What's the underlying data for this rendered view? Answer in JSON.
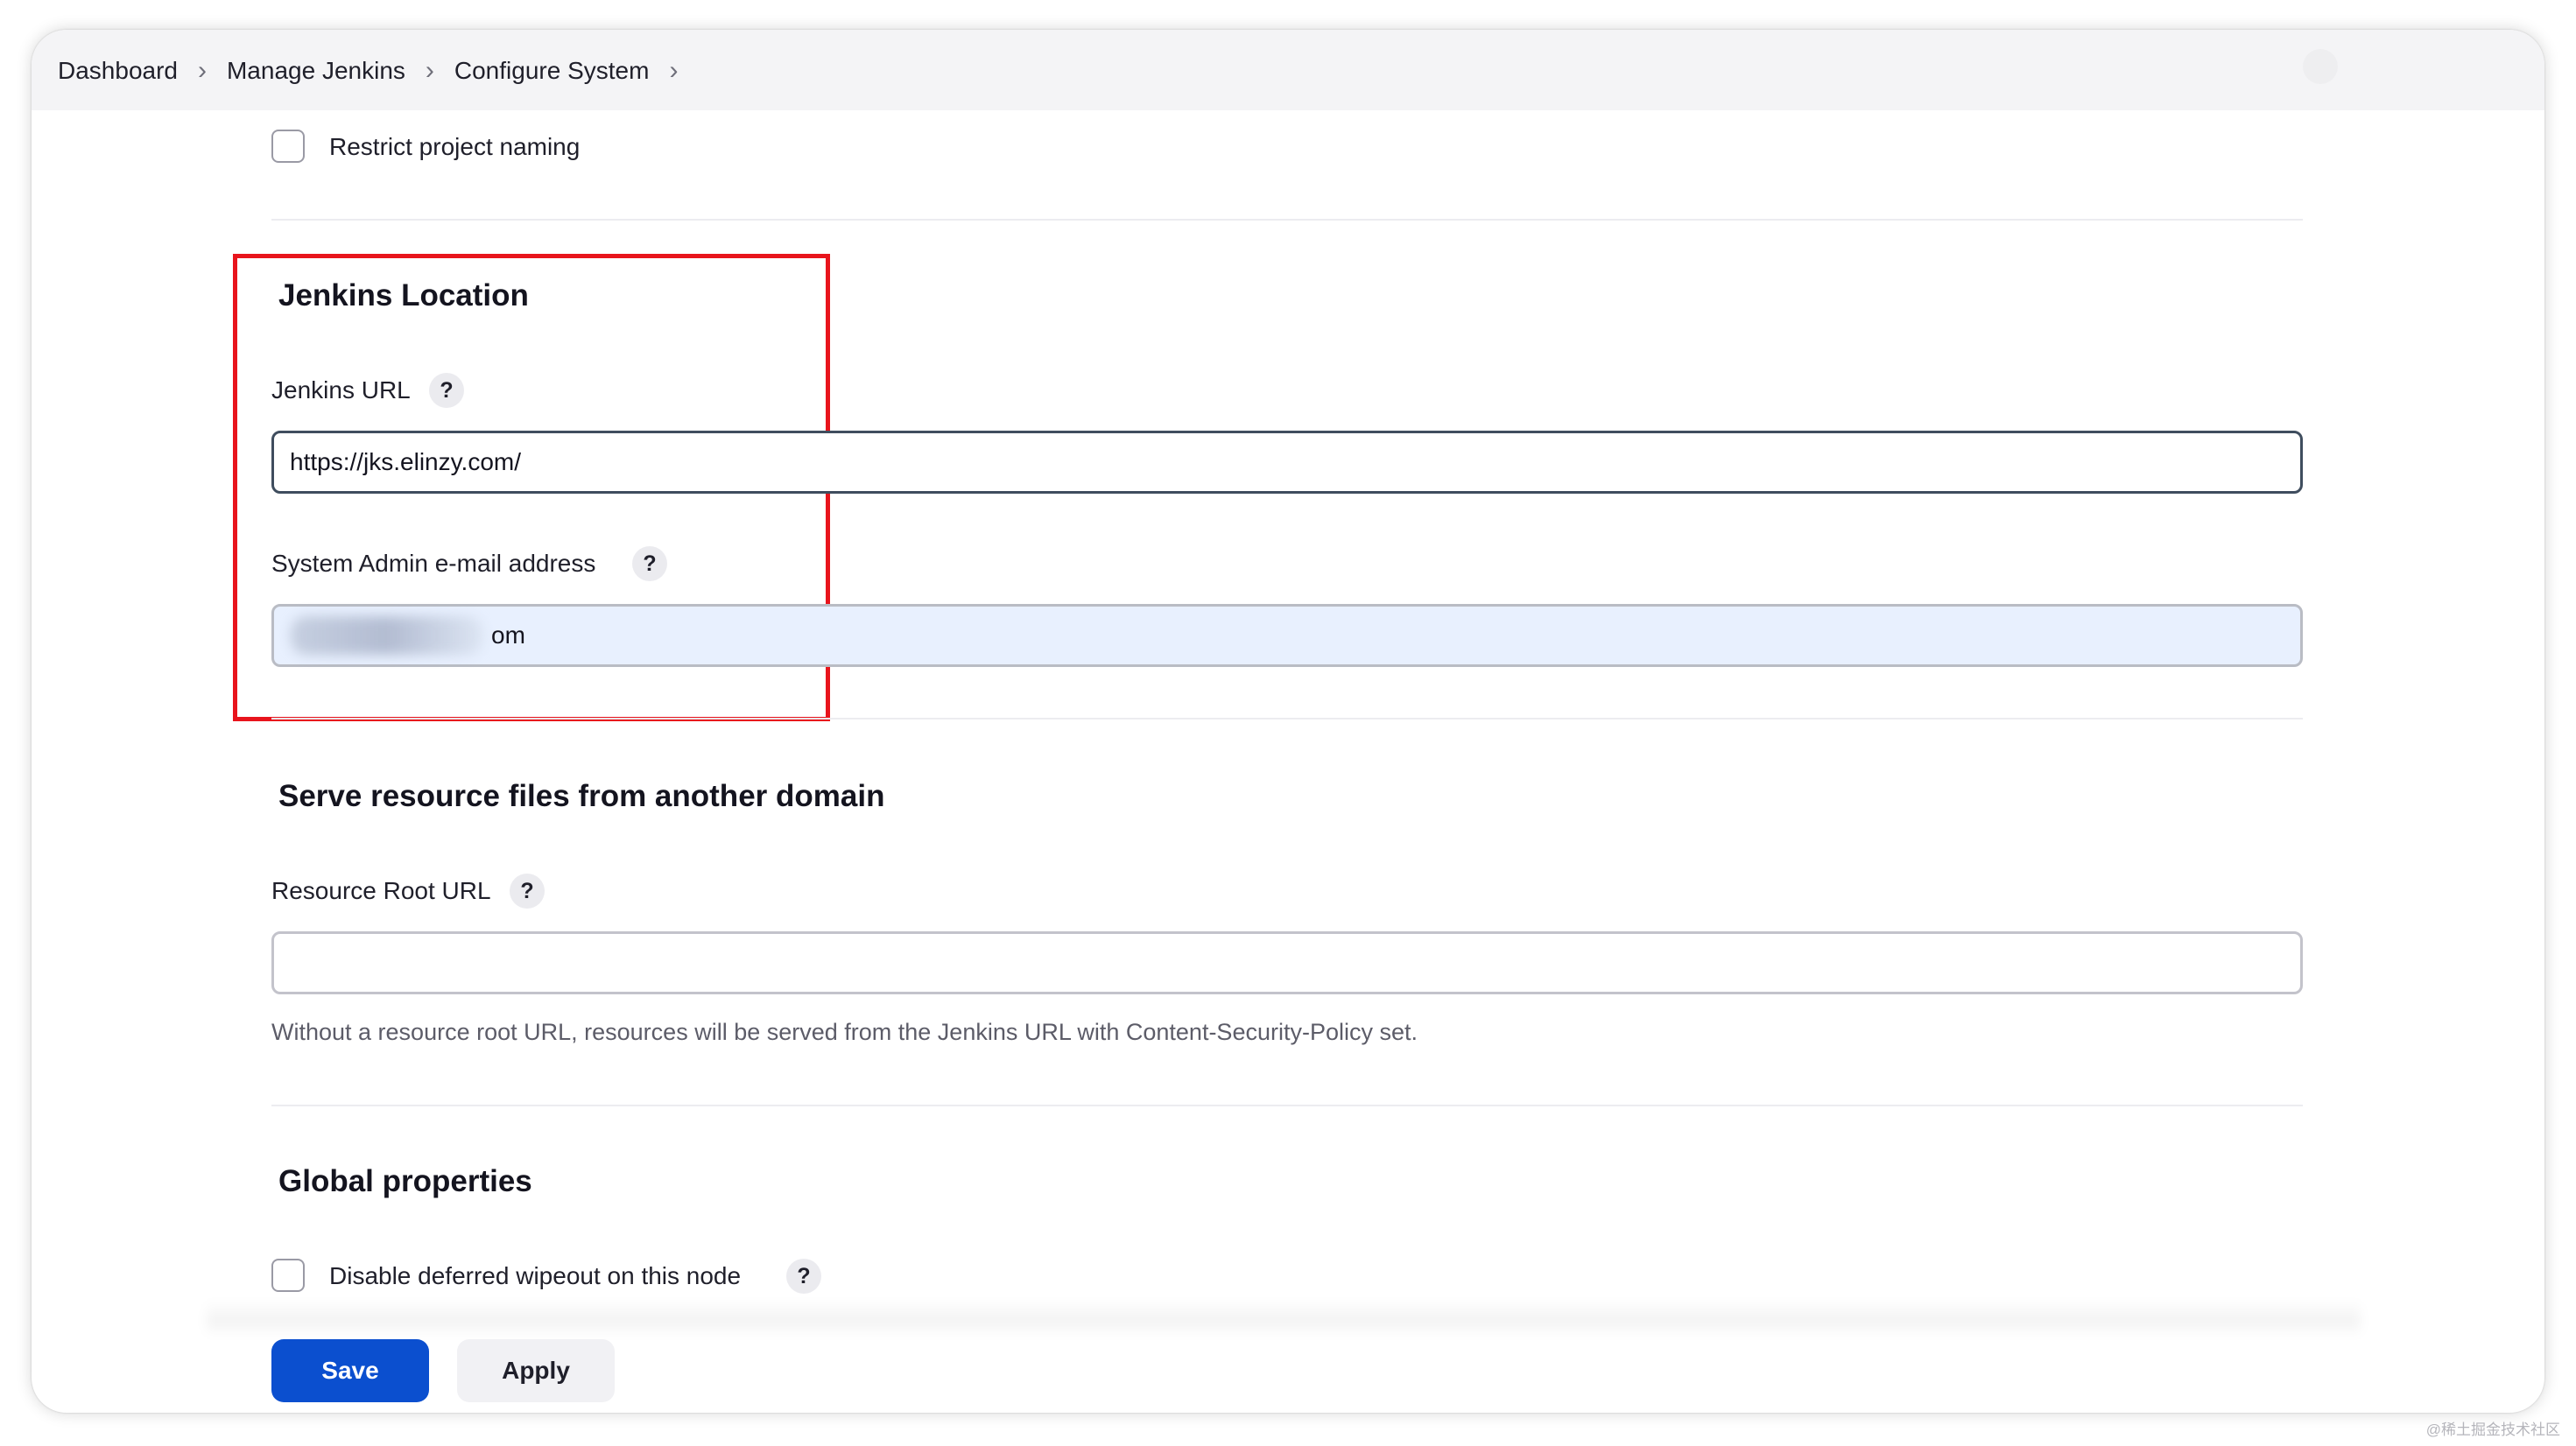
{
  "breadcrumb": {
    "items": [
      "Dashboard",
      "Manage Jenkins",
      "Configure System"
    ],
    "separator": ">"
  },
  "restrict_project_naming": {
    "label": "Restrict project naming",
    "checked": false
  },
  "jenkins_location": {
    "title": "Jenkins Location",
    "url_label": "Jenkins URL",
    "url_value": "https://jks.elinzy.com/",
    "email_label": "System Admin e-mail address",
    "email_value": "om"
  },
  "resource_domain": {
    "title": "Serve resource files from another domain",
    "root_url_label": "Resource Root URL",
    "root_url_value": "",
    "hint": "Without a resource root URL, resources will be served from the Jenkins URL with Content-Security-Policy set."
  },
  "global_properties": {
    "title": "Global properties",
    "disable_wipeout_label": "Disable deferred wipeout on this node",
    "checked": false
  },
  "help_glyph": "?",
  "buttons": {
    "save": "Save",
    "apply": "Apply"
  },
  "watermark": "@稀土掘金技术社区",
  "colors": {
    "primary": "#0b4fcf",
    "highlight_box": "#e8141c",
    "autofill_bg": "#e8f0fe"
  }
}
